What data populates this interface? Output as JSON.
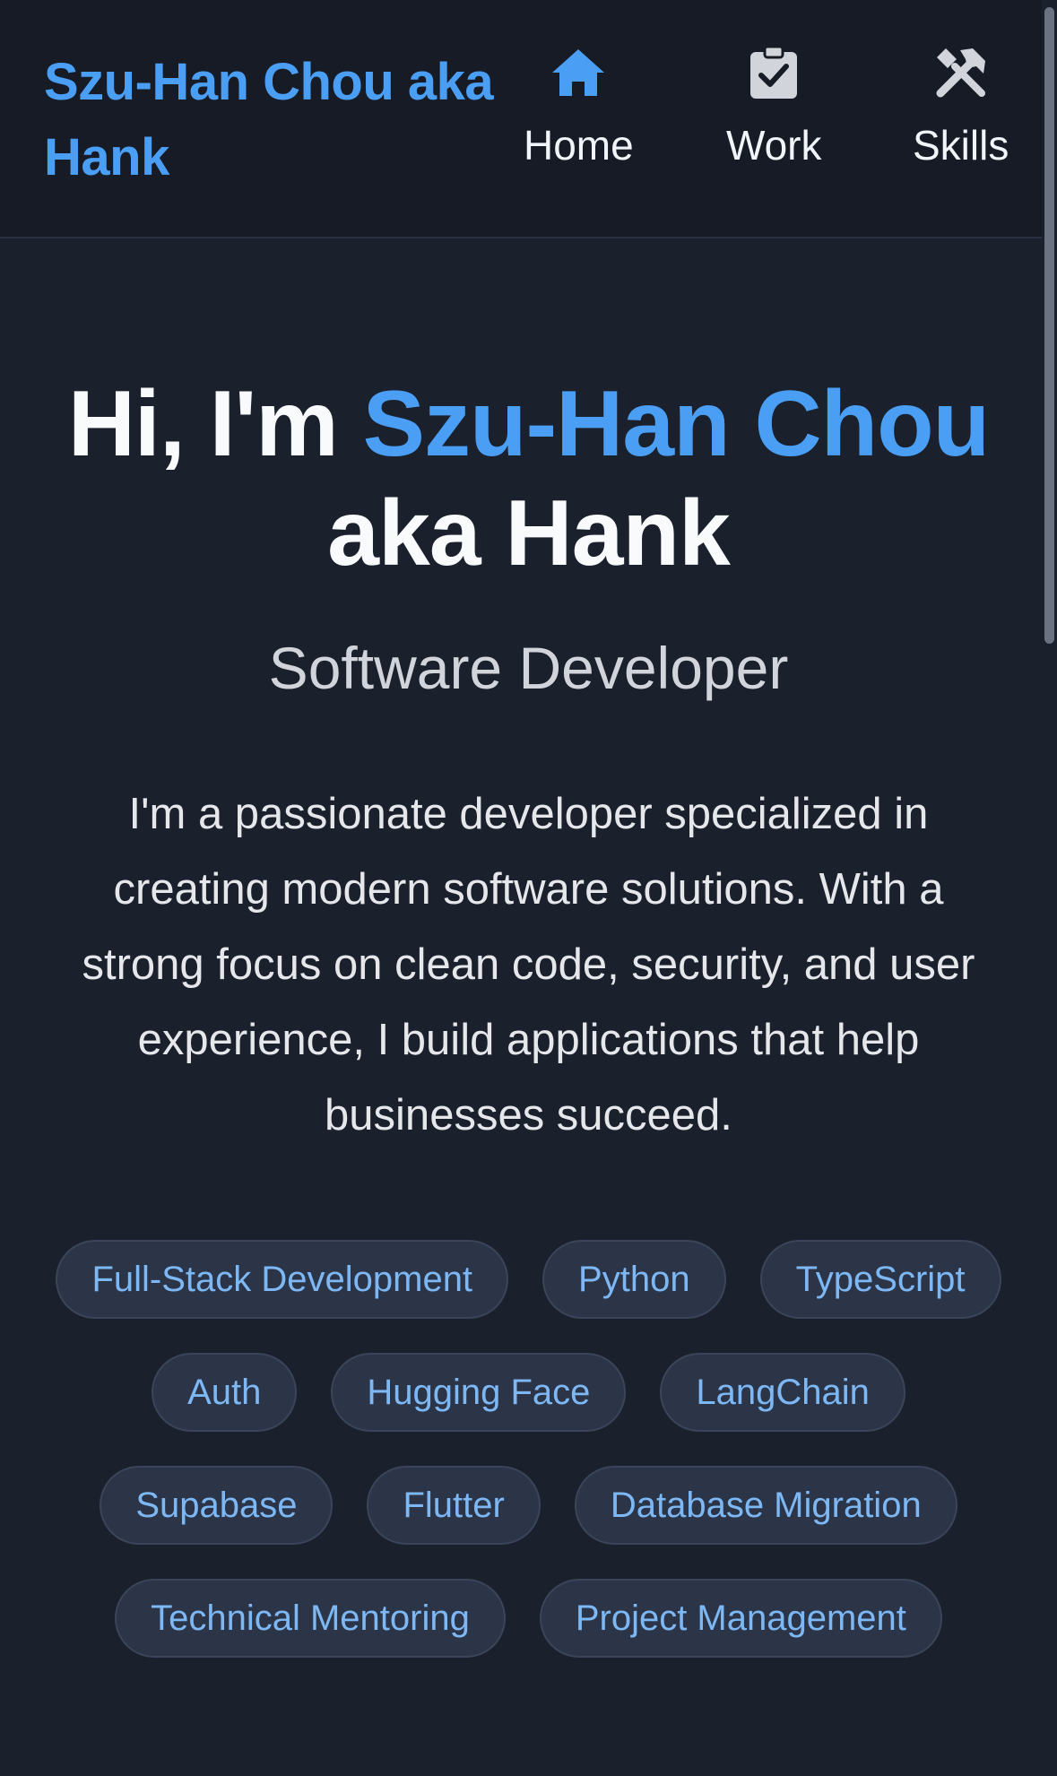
{
  "header": {
    "brand": "Szu-Han Chou aka Hank",
    "nav": [
      {
        "label": "Home",
        "icon": "home-icon",
        "color": "#4a9ff5"
      },
      {
        "label": "Work",
        "icon": "clipboard-check-icon",
        "color": "#d1d5db"
      },
      {
        "label": "Skills",
        "icon": "tools-icon",
        "color": "#d1d5db"
      }
    ]
  },
  "hero": {
    "greeting": "Hi, I'm ",
    "name": "Szu-Han Chou",
    "suffix": " aka Hank",
    "subtitle": "Software Developer",
    "bio": "I'm a passionate developer specialized in creating modern software solutions. With a strong focus on clean code, security, and user experience, I build applications that help businesses succeed."
  },
  "tags": [
    "Full-Stack Development",
    "Python",
    "TypeScript",
    "Auth",
    "Hugging Face",
    "LangChain",
    "Supabase",
    "Flutter",
    "Database Migration",
    "Technical Mentoring",
    "Project Management"
  ],
  "colors": {
    "background": "#1a202c",
    "header_background": "#171b26",
    "accent": "#4a9ff5",
    "tag_background": "#2c3548",
    "tag_text": "#7db8f5"
  }
}
